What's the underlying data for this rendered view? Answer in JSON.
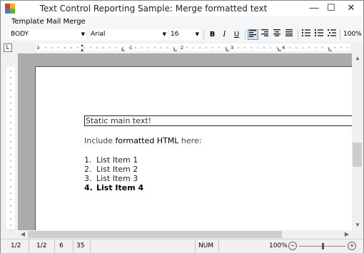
{
  "window": {
    "title": "Text Control Reporting Sample: Merge formatted text",
    "minimize_glyph": "—",
    "maximize_glyph": "☐",
    "close_glyph": "✕"
  },
  "menu": {
    "items": [
      "Template",
      "Mail Merge"
    ]
  },
  "toolbar": {
    "style_value": "BODY",
    "font_value": "Arial",
    "size_value": "16",
    "bold_label": "B",
    "italic_label": "I",
    "underline_label": "U",
    "align_left_active": true,
    "zoom_label": "100%"
  },
  "ruler": {
    "numbers": [
      "1",
      "1",
      "2",
      "3",
      "4"
    ]
  },
  "document": {
    "static_text": "Static main text!",
    "include_prefix": "Include ",
    "include_bold": "formatted HTML",
    "include_suffix": " here:",
    "list": [
      {
        "num": "1.",
        "text": "List Item 1",
        "bold": false
      },
      {
        "num": "2.",
        "text": "List Item 2",
        "bold": false
      },
      {
        "num": "3.",
        "text": "List Item 3",
        "bold": false
      },
      {
        "num": "4.",
        "text": "List Item 4",
        "bold": true
      }
    ]
  },
  "status": {
    "page": "1/2",
    "section": "1/2",
    "line": "6",
    "column": "35",
    "num": "NUM",
    "zoom": "100%"
  },
  "icons": {
    "minus": "zoom-out-icon",
    "plus": "zoom-in-icon"
  }
}
